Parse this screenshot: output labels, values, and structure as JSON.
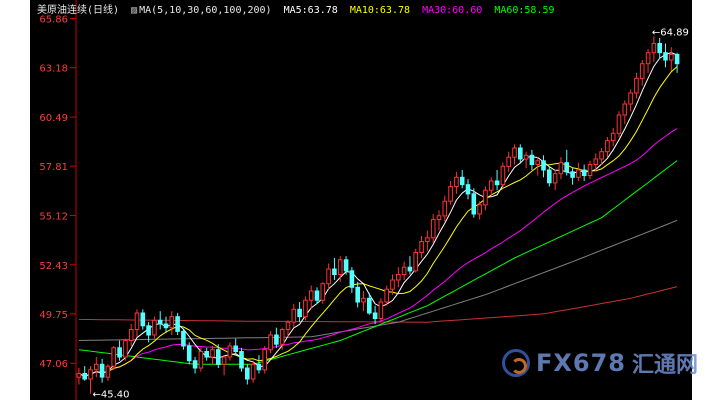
{
  "legend": {
    "instrument": "美原油连续",
    "period": "(日线)",
    "ma_def": "MA(5,10,30,60,100,200)",
    "ma5": "MA5:63.78",
    "ma10": "MA10:63.78",
    "ma30": "MA30:60.60",
    "ma60": "MA60:58.59"
  },
  "colors": {
    "background": "#000000",
    "up": "#ff3232",
    "down": "#54ffff",
    "ma5": "#ffffff",
    "ma10": "#ffff00",
    "ma30": "#ff00ff",
    "ma60": "#00ff00",
    "ma100": "#808080",
    "ma200": "#c83232",
    "axis": "#cc0000",
    "tick": "#ff3c3c"
  },
  "annotations": {
    "high": "64.89",
    "low": "45.40"
  },
  "watermark": {
    "brand": "FX678",
    "cn": "汇通网"
  },
  "chart_data": {
    "type": "candlestick",
    "title": "美原油连续(日线)",
    "ylim": [
      45.6,
      66.0
    ],
    "y_ticks": [
      "65.86",
      "63.18",
      "60.49",
      "57.81",
      "55.12",
      "52.43",
      "49.75",
      "47.06"
    ],
    "candles_ohlc": [
      [
        46.3,
        46.8,
        45.9,
        46.5
      ],
      [
        46.5,
        46.9,
        46.1,
        46.2
      ],
      [
        46.2,
        46.9,
        45.4,
        46.7
      ],
      [
        46.7,
        47.4,
        46.3,
        47.0
      ],
      [
        47.0,
        47.3,
        46.0,
        46.3
      ],
      [
        46.3,
        47.0,
        46.1,
        46.9
      ],
      [
        46.9,
        48.0,
        46.7,
        47.9
      ],
      [
        47.9,
        48.3,
        47.2,
        47.4
      ],
      [
        47.4,
        48.4,
        47.2,
        48.3
      ],
      [
        48.3,
        49.2,
        48.0,
        48.9
      ],
      [
        48.9,
        50.0,
        48.5,
        49.8
      ],
      [
        49.8,
        50.0,
        48.9,
        49.1
      ],
      [
        49.1,
        49.3,
        48.2,
        48.6
      ],
      [
        48.6,
        49.6,
        48.4,
        49.4
      ],
      [
        49.4,
        49.9,
        48.9,
        49.2
      ],
      [
        49.2,
        49.6,
        48.7,
        49.0
      ],
      [
        49.0,
        49.9,
        48.6,
        49.6
      ],
      [
        49.6,
        49.8,
        48.6,
        48.8
      ],
      [
        48.8,
        48.9,
        47.8,
        48.0
      ],
      [
        48.0,
        48.2,
        47.0,
        47.2
      ],
      [
        47.2,
        47.4,
        46.5,
        46.8
      ],
      [
        46.8,
        47.9,
        46.6,
        47.7
      ],
      [
        47.7,
        47.9,
        47.2,
        47.4
      ],
      [
        47.4,
        48.0,
        47.0,
        47.8
      ],
      [
        47.8,
        48.1,
        46.8,
        47.0
      ],
      [
        47.0,
        47.5,
        46.4,
        47.4
      ],
      [
        47.4,
        48.2,
        47.2,
        48.0
      ],
      [
        48.0,
        48.4,
        47.5,
        47.7
      ],
      [
        47.7,
        47.9,
        46.6,
        46.8
      ],
      [
        46.8,
        47.0,
        45.9,
        46.2
      ],
      [
        46.2,
        47.2,
        46.0,
        47.0
      ],
      [
        47.0,
        47.5,
        46.5,
        46.7
      ],
      [
        46.7,
        48.0,
        46.5,
        47.8
      ],
      [
        47.8,
        48.8,
        47.6,
        48.6
      ],
      [
        48.6,
        49.0,
        47.9,
        48.1
      ],
      [
        48.1,
        49.0,
        47.8,
        48.9
      ],
      [
        48.9,
        49.4,
        48.5,
        49.3
      ],
      [
        49.3,
        50.3,
        49.0,
        50.0
      ],
      [
        50.0,
        50.4,
        49.3,
        49.6
      ],
      [
        49.6,
        50.7,
        49.4,
        50.5
      ],
      [
        50.5,
        51.3,
        50.0,
        51.0
      ],
      [
        51.0,
        51.2,
        50.3,
        50.5
      ],
      [
        50.5,
        51.5,
        50.3,
        51.4
      ],
      [
        51.4,
        52.5,
        51.1,
        52.2
      ],
      [
        52.2,
        52.8,
        51.6,
        51.9
      ],
      [
        51.9,
        52.9,
        51.5,
        52.7
      ],
      [
        52.7,
        52.9,
        51.9,
        52.1
      ],
      [
        52.1,
        52.3,
        50.9,
        51.2
      ],
      [
        51.2,
        51.5,
        50.1,
        50.4
      ],
      [
        50.4,
        51.0,
        49.9,
        50.6
      ],
      [
        50.6,
        50.9,
        49.7,
        49.8
      ],
      [
        49.8,
        50.2,
        49.2,
        49.5
      ],
      [
        49.5,
        50.6,
        49.3,
        50.4
      ],
      [
        50.4,
        51.3,
        50.2,
        51.1
      ],
      [
        51.1,
        51.9,
        50.8,
        51.6
      ],
      [
        51.6,
        52.3,
        51.2,
        51.9
      ],
      [
        51.9,
        52.6,
        51.6,
        52.3
      ],
      [
        52.3,
        52.9,
        51.9,
        52.1
      ],
      [
        52.1,
        53.3,
        52.0,
        53.1
      ],
      [
        53.1,
        54.0,
        52.8,
        53.7
      ],
      [
        53.7,
        54.3,
        53.2,
        53.9
      ],
      [
        53.9,
        55.2,
        53.6,
        54.9
      ],
      [
        54.9,
        55.4,
        54.3,
        55.1
      ],
      [
        55.1,
        56.2,
        54.8,
        55.9
      ],
      [
        55.9,
        57.0,
        55.7,
        56.7
      ],
      [
        56.7,
        57.5,
        56.3,
        57.2
      ],
      [
        57.2,
        57.6,
        56.6,
        56.8
      ],
      [
        56.8,
        57.1,
        56.0,
        56.3
      ],
      [
        56.3,
        56.6,
        55.0,
        55.2
      ],
      [
        55.2,
        55.9,
        54.9,
        55.7
      ],
      [
        55.7,
        56.7,
        55.4,
        56.5
      ],
      [
        56.5,
        57.2,
        56.2,
        57.0
      ],
      [
        57.0,
        57.6,
        56.5,
        56.8
      ],
      [
        56.8,
        58.0,
        56.6,
        57.8
      ],
      [
        57.8,
        58.6,
        57.5,
        58.3
      ],
      [
        58.3,
        59.0,
        57.9,
        58.8
      ],
      [
        58.8,
        59.0,
        58.0,
        58.2
      ],
      [
        58.2,
        58.6,
        57.7,
        58.4
      ],
      [
        58.4,
        58.7,
        57.6,
        57.9
      ],
      [
        57.9,
        58.3,
        57.3,
        58.1
      ],
      [
        58.1,
        58.4,
        57.2,
        57.6
      ],
      [
        57.6,
        57.8,
        56.7,
        56.9
      ],
      [
        56.9,
        57.6,
        56.5,
        57.4
      ],
      [
        57.4,
        58.3,
        57.1,
        58.0
      ],
      [
        58.0,
        58.7,
        57.3,
        57.5
      ],
      [
        57.5,
        57.7,
        56.8,
        57.2
      ],
      [
        57.2,
        58.0,
        57.0,
        57.6
      ],
      [
        57.6,
        57.9,
        57.0,
        57.3
      ],
      [
        57.3,
        58.1,
        57.1,
        57.9
      ],
      [
        57.9,
        58.5,
        57.5,
        58.2
      ],
      [
        58.2,
        58.8,
        57.9,
        58.6
      ],
      [
        58.6,
        59.4,
        58.3,
        59.2
      ],
      [
        59.2,
        59.9,
        58.9,
        59.6
      ],
      [
        59.6,
        60.8,
        59.4,
        60.6
      ],
      [
        60.6,
        61.4,
        60.1,
        61.2
      ],
      [
        61.2,
        62.0,
        60.8,
        61.8
      ],
      [
        61.8,
        62.9,
        61.5,
        62.6
      ],
      [
        62.6,
        63.6,
        62.2,
        63.4
      ],
      [
        63.4,
        64.2,
        62.9,
        64.0
      ],
      [
        64.0,
        64.89,
        63.5,
        64.5
      ],
      [
        64.5,
        64.8,
        63.7,
        64.0
      ],
      [
        64.0,
        64.5,
        63.2,
        63.6
      ],
      [
        63.6,
        64.3,
        63.0,
        63.9
      ],
      [
        63.9,
        64.0,
        62.9,
        63.4
      ]
    ],
    "series": [
      {
        "name": "MA5",
        "last": 63.78
      },
      {
        "name": "MA10",
        "last": 63.78
      },
      {
        "name": "MA30",
        "last": 60.6
      },
      {
        "name": "MA60",
        "last": 58.59
      }
    ],
    "ma100_points": [
      [
        0,
        48.3
      ],
      [
        20,
        48.4
      ],
      [
        40,
        48.5
      ],
      [
        55,
        49.3
      ],
      [
        70,
        50.8
      ],
      [
        85,
        52.6
      ],
      [
        105,
        55.1
      ]
    ],
    "ma200_points": [
      [
        0,
        49.45
      ],
      [
        30,
        49.35
      ],
      [
        60,
        49.3
      ],
      [
        80,
        49.75
      ],
      [
        95,
        50.6
      ],
      [
        105,
        51.4
      ]
    ],
    "ma60_anchor": [
      [
        0,
        47.8
      ],
      [
        20,
        47.0
      ],
      [
        30,
        47.0
      ],
      [
        45,
        48.3
      ],
      [
        60,
        50.2
      ],
      [
        75,
        52.8
      ],
      [
        90,
        55.0
      ],
      [
        105,
        58.59
      ]
    ]
  }
}
